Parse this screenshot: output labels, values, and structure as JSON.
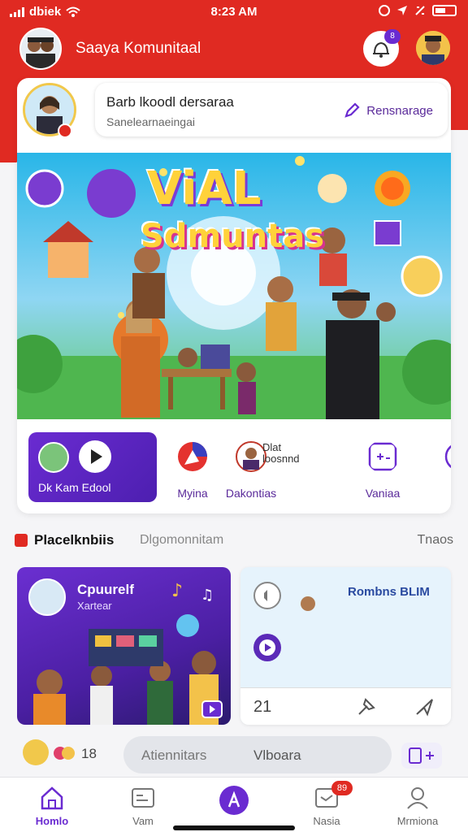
{
  "status_bar": {
    "carrier": "dbiek",
    "time": "8:23 AM"
  },
  "header": {
    "title": "Saaya Komunitaal",
    "notification_badge": "8"
  },
  "composer": {
    "title": "Barb lkoodl dersaraa",
    "subtitle": "Sanelearnaeingai",
    "action_label": "Rensnarage"
  },
  "banner": {
    "title_line1": "ViAL",
    "title_line2": "Sdmuntas"
  },
  "quick_actions": {
    "live_label": "Dk Kam Edool",
    "items": [
      {
        "label": "Myina",
        "icon": "compass-icon"
      },
      {
        "label": "Dakontias",
        "icon": "community-icon"
      },
      {
        "label": "Vaniaa",
        "icon": "video-icon"
      }
    ],
    "detail_line1": "Dlat",
    "detail_line2": "loosnnd"
  },
  "section": {
    "title": "Placelknbiis",
    "subtitle": "Dlgomonnitam",
    "link": "Tnaos"
  },
  "card_left": {
    "title": "Cpuurelf",
    "subtitle": "Xartear"
  },
  "card_right": {
    "title": "Rombns BLIM",
    "count": "21"
  },
  "bottom_strip": {
    "count": "18",
    "pill_left": "Atiennitars",
    "pill_right": "Vlboara"
  },
  "tabbar": {
    "tabs": [
      {
        "label": "Homlo",
        "active": true
      },
      {
        "label": "Vam",
        "active": false
      },
      {
        "label": "",
        "active": false
      },
      {
        "label": "Nasia",
        "active": false,
        "badge": "89"
      },
      {
        "label": "Mrmiona",
        "active": false
      }
    ]
  },
  "colors": {
    "brand_red": "#e02a22",
    "accent_purple": "#6a2bd1"
  }
}
